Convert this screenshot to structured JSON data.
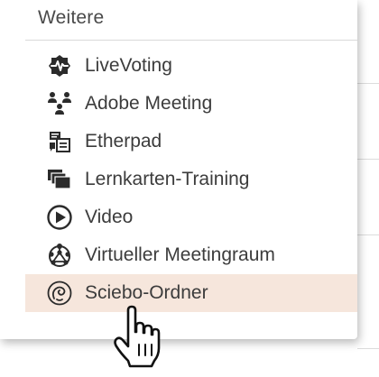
{
  "menu": {
    "heading": "Weitere",
    "items": [
      {
        "label": "LiveVoting",
        "icon": "live-voting-icon"
      },
      {
        "label": "Adobe Meeting",
        "icon": "adobe-meeting-icon"
      },
      {
        "label": "Etherpad",
        "icon": "etherpad-icon"
      },
      {
        "label": "Lernkarten-Training",
        "icon": "flashcards-icon"
      },
      {
        "label": "Video",
        "icon": "video-play-icon"
      },
      {
        "label": "Virtueller Meetingraum",
        "icon": "virtual-meeting-room-icon"
      },
      {
        "label": "Sciebo-Ordner",
        "icon": "sciebo-folder-icon",
        "highlighted": true
      }
    ]
  },
  "colors": {
    "highlight": "#f6e6dc",
    "text": "#3c3c3c",
    "icon": "#2b2b2b"
  },
  "cursor": {
    "icon": "hand-pointer-cursor-icon"
  }
}
